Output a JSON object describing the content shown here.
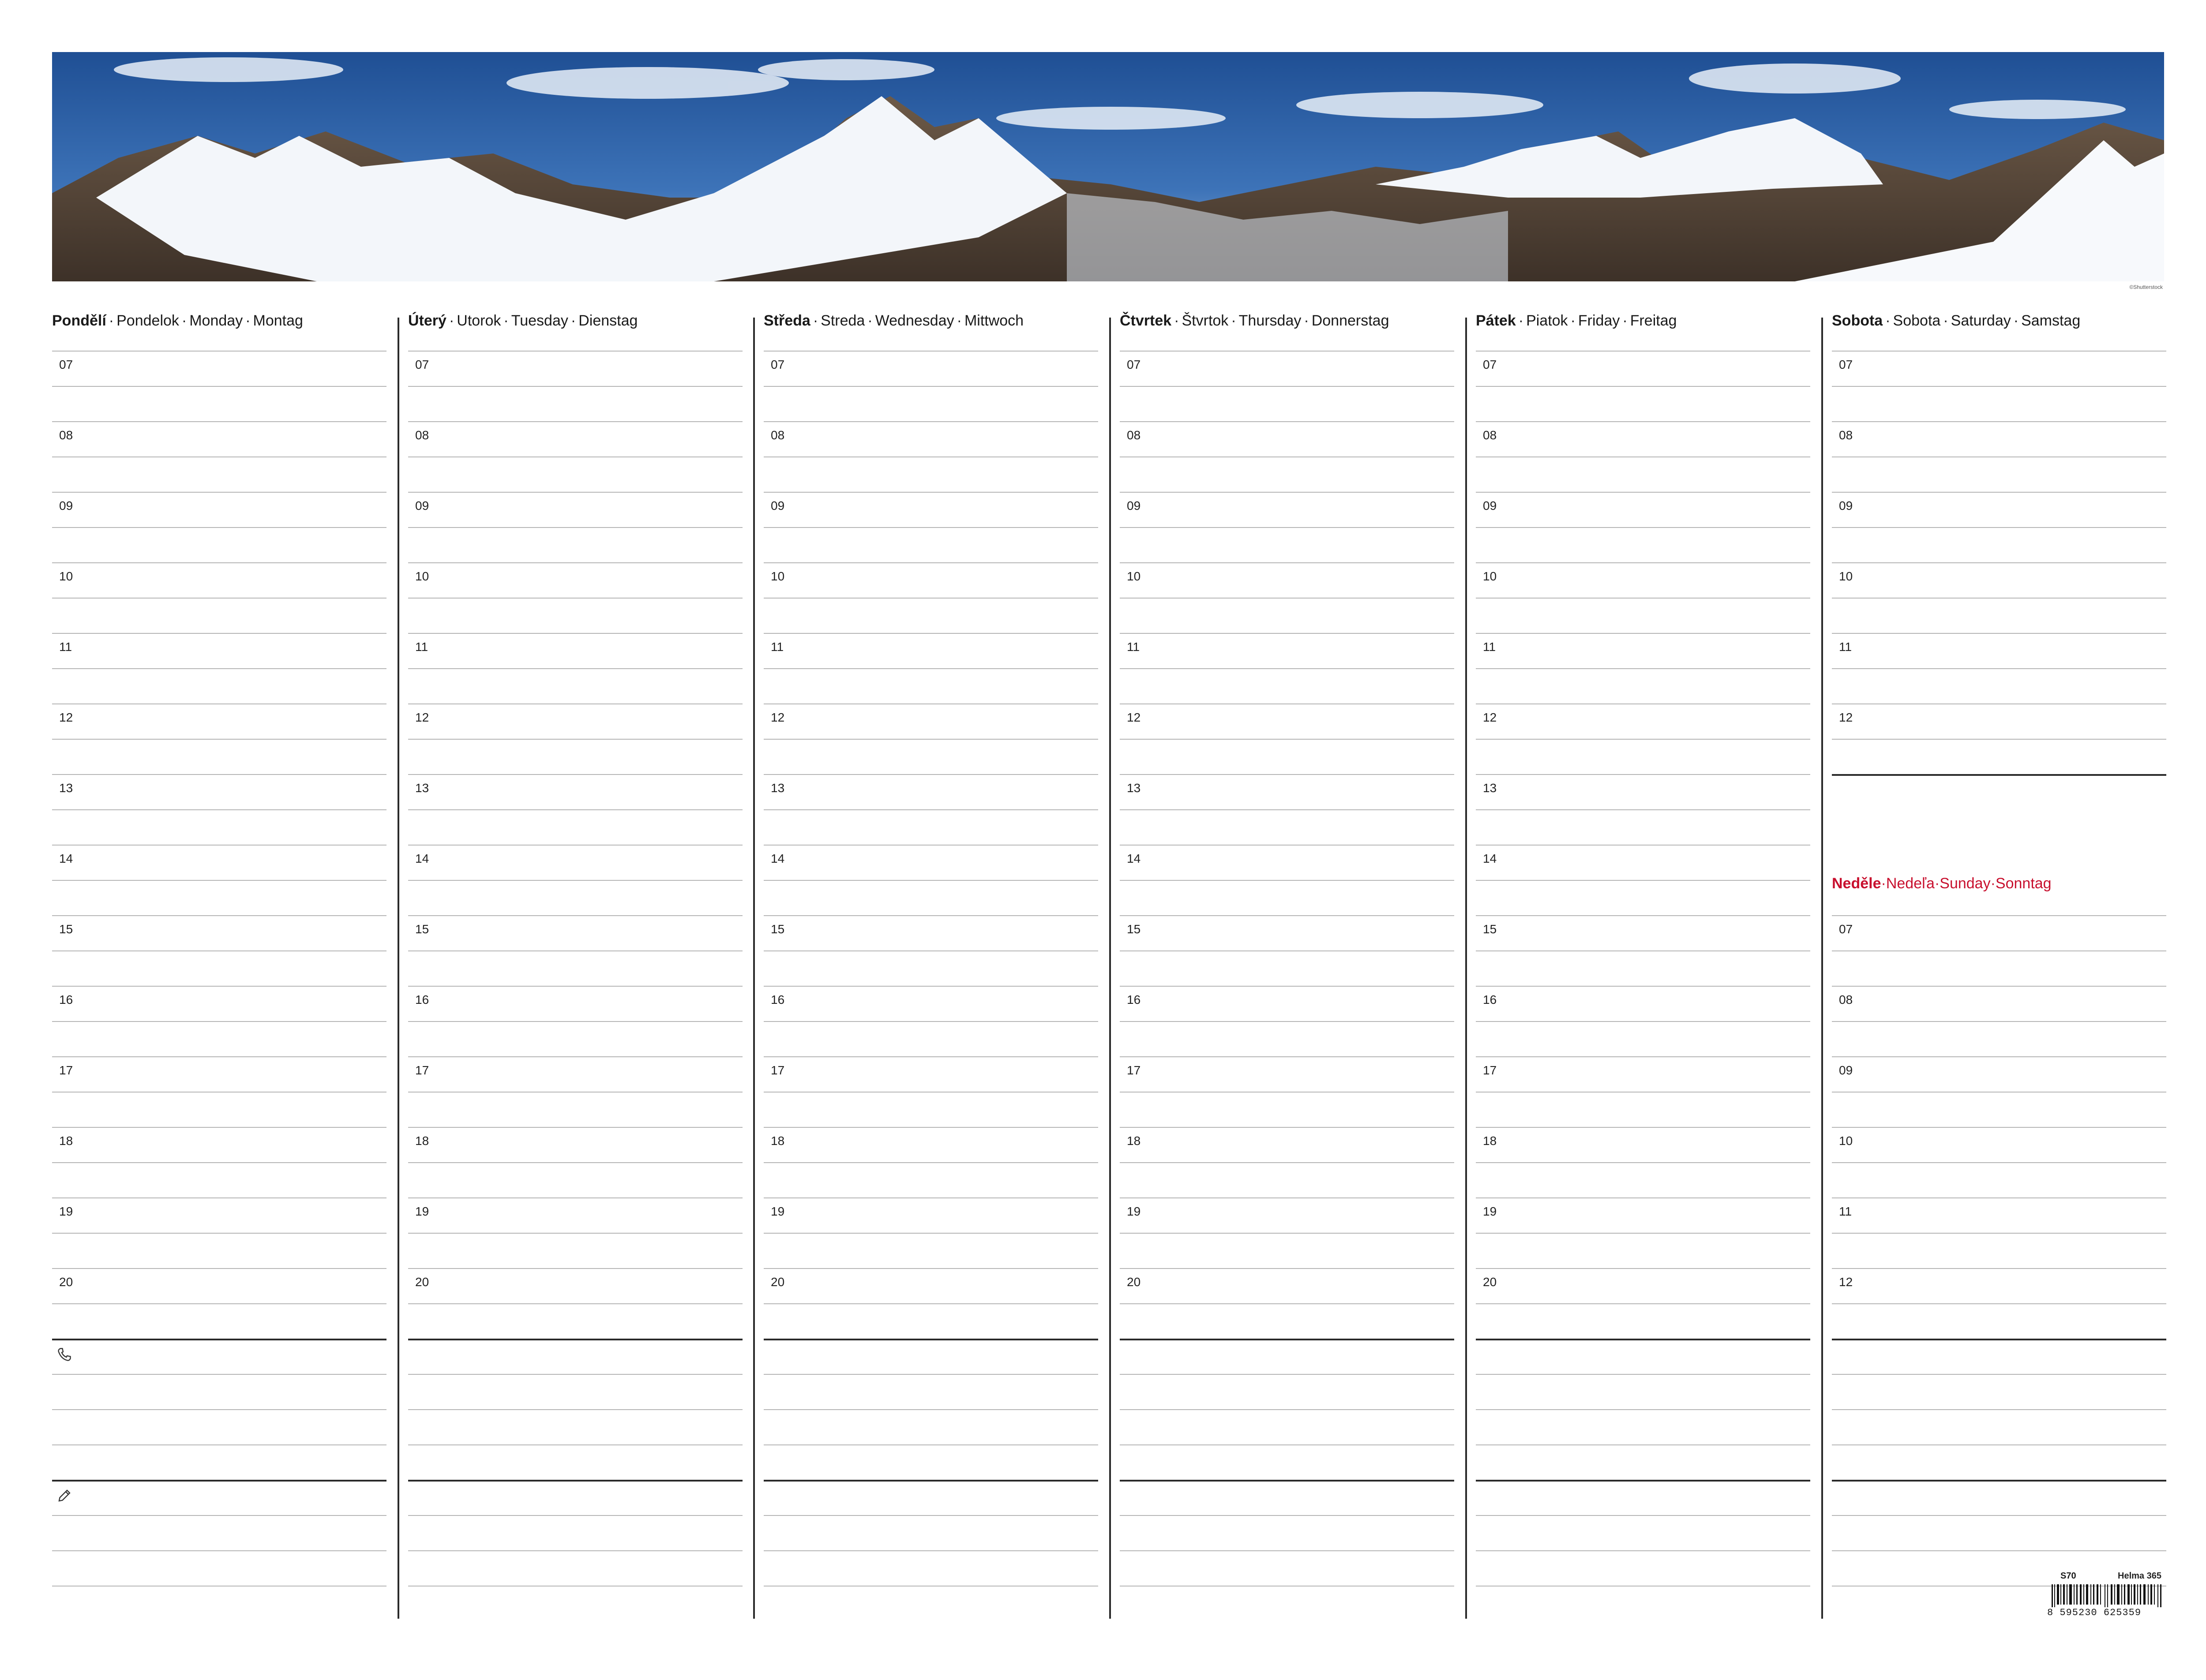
{
  "banner": {
    "credit": "©Shutterstock"
  },
  "hours": [
    "07",
    "08",
    "09",
    "10",
    "11",
    "12",
    "13",
    "14",
    "15",
    "16",
    "17",
    "18",
    "19",
    "20"
  ],
  "sunday_hours": [
    "07",
    "08",
    "09",
    "10",
    "11",
    "12"
  ],
  "days": [
    {
      "name": "Pondělí",
      "sk": "Pondelok",
      "en": "Monday",
      "de": "Montag"
    },
    {
      "name": "Úterý",
      "sk": "Utorok",
      "en": "Tuesday",
      "de": "Dienstag"
    },
    {
      "name": "Středa",
      "sk": "Streda",
      "en": "Wednesday",
      "de": "Mittwoch"
    },
    {
      "name": "Čtvrtek",
      "sk": "Štvrtok",
      "en": "Thursday",
      "de": "Donnerstag"
    },
    {
      "name": "Pátek",
      "sk": "Piatok",
      "en": "Friday",
      "de": "Freitag"
    },
    {
      "name": "Sobota",
      "sk": "Sobota",
      "en": "Saturday",
      "de": "Samstag"
    }
  ],
  "sunday": {
    "name": "Neděle",
    "sk": "Nedeľa",
    "en": "Sunday",
    "de": "Sonntag"
  },
  "icons": {
    "notes_phone": "phone-icon",
    "notes_pencil": "pencil-icon"
  },
  "colors": {
    "sunday": "#c8102e",
    "lines": "#b5b5b5",
    "dividers": "#2a2a2a"
  },
  "footer": {
    "code": "S70",
    "brand": "Helma 365",
    "ean": "8 595230 625359"
  }
}
